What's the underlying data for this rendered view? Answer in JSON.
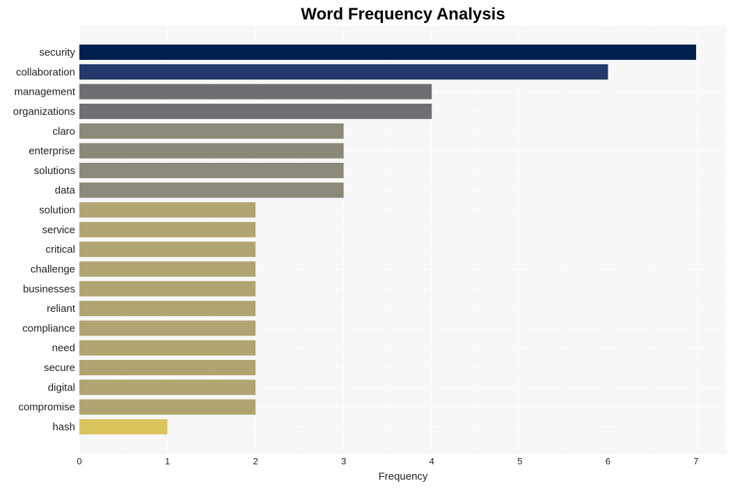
{
  "chart_data": {
    "type": "bar",
    "orientation": "horizontal",
    "title": "Word Frequency Analysis",
    "xlabel": "Frequency",
    "ylabel": "",
    "xlim": [
      0,
      7.35
    ],
    "xticks": [
      0,
      1,
      2,
      3,
      4,
      5,
      6,
      7
    ],
    "grid": true,
    "categories": [
      "security",
      "collaboration",
      "management",
      "organizations",
      "claro",
      "enterprise",
      "solutions",
      "data",
      "solution",
      "service",
      "critical",
      "challenge",
      "businesses",
      "reliant",
      "compliance",
      "need",
      "secure",
      "digital",
      "compromise",
      "hash"
    ],
    "values": [
      7,
      6,
      4,
      4,
      3,
      3,
      3,
      3,
      2,
      2,
      2,
      2,
      2,
      2,
      2,
      2,
      2,
      2,
      2,
      1
    ],
    "colors": [
      "#00214d",
      "#213a6b",
      "#6e6f73",
      "#6e6f73",
      "#8d897a",
      "#8d897a",
      "#8d897a",
      "#8d897a",
      "#b0a571",
      "#b0a571",
      "#b0a571",
      "#b0a571",
      "#b0a571",
      "#b0a571",
      "#b0a571",
      "#b0a571",
      "#b0a571",
      "#b0a571",
      "#b0a571",
      "#dac45c"
    ],
    "plot_background": "#f7f7f7"
  }
}
